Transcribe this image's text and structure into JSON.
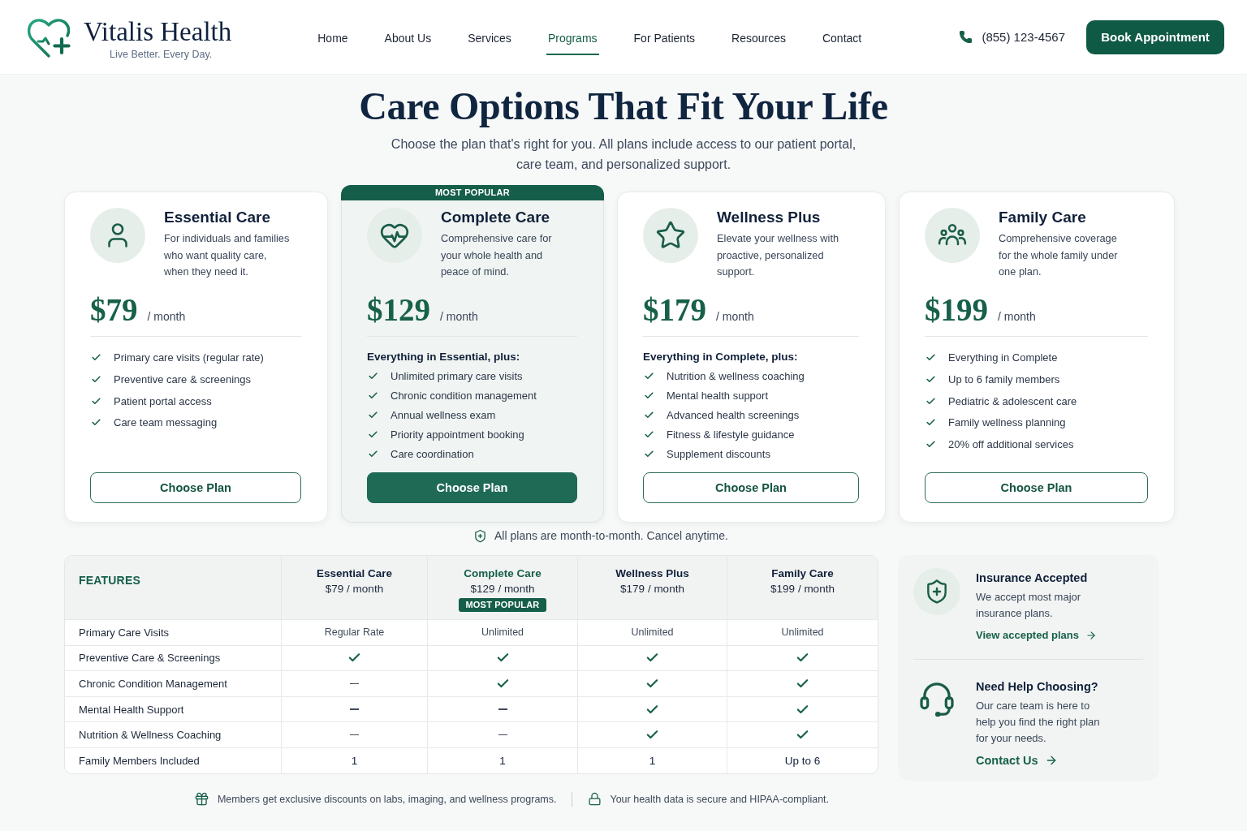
{
  "header": {
    "brand": {
      "name": "Vitalis Health",
      "tagline": "Live Better. Every Day."
    },
    "nav": [
      {
        "label": "Home",
        "selected": false
      },
      {
        "label": "About Us",
        "selected": false
      },
      {
        "label": "Services",
        "selected": false
      },
      {
        "label": "Programs",
        "selected": true
      },
      {
        "label": "For Patients",
        "selected": false
      },
      {
        "label": "Resources",
        "selected": false
      },
      {
        "label": "Contact",
        "selected": false
      }
    ],
    "phone": "(855) 123-4567",
    "cta": "Book Appointment"
  },
  "hero": {
    "title": "Care Options That Fit Your Life",
    "subtitle": "Choose the plan that's right for you. All plans include access to our patient portal, care team, and personalized support."
  },
  "plans": [
    {
      "name": "Essential Care",
      "description": "For individuals and families who want quality care, when they need it.",
      "price": "$79",
      "period": "/ month",
      "highlighted": false,
      "features": [
        "Primary care visits (regular rate)",
        "Preventive care & screenings",
        "Patient portal access",
        "Care team messaging"
      ],
      "button": "Choose Plan"
    },
    {
      "badge": "MOST POPULAR",
      "name": "Complete Care",
      "description": "Comprehensive care for your whole health and peace of mind.",
      "price": "$129",
      "period": "/ month",
      "highlighted": true,
      "features_heading": "Everything in Essential, plus:",
      "features": [
        "Unlimited primary care visits",
        "Chronic condition management",
        "Annual wellness exam",
        "Priority appointment booking",
        "Care coordination"
      ],
      "button": "Choose Plan"
    },
    {
      "name": "Wellness Plus",
      "description": "Elevate your wellness with proactive, personalized support.",
      "price": "$179",
      "period": "/ month",
      "highlighted": false,
      "features_heading": "Everything in Complete, plus:",
      "features": [
        "Nutrition & wellness coaching",
        "Mental health support",
        "Advanced health screenings",
        "Fitness & lifestyle guidance",
        "Supplement discounts"
      ],
      "button": "Choose Plan"
    },
    {
      "name": "Family Care",
      "description": "Comprehensive coverage for the whole family under one plan.",
      "price": "$199",
      "period": "/ month",
      "highlighted": false,
      "features": [
        "Everything in Complete",
        "Up to 6 family members",
        "Pediatric & adolescent care",
        "Family wellness planning",
        "20% off additional services"
      ],
      "button": "Choose Plan"
    }
  ],
  "plans_note": "All plans are month-to-month. Cancel anytime.",
  "comparison": {
    "label": "FEATURES",
    "plans": [
      {
        "name": "Essential Care",
        "price": "$79 / month",
        "highlighted": false
      },
      {
        "name": "Complete Care",
        "price": "$129 / month",
        "badge": "MOST POPULAR",
        "highlighted": true
      },
      {
        "name": "Wellness Plus",
        "price": "$179 / month",
        "highlighted": false
      },
      {
        "name": "Family Care",
        "price": "$199 / month",
        "highlighted": false
      }
    ],
    "rows": [
      {
        "feature": "Primary Care Visits",
        "cells": [
          {
            "kind": "text",
            "text": "Regular Rate"
          },
          {
            "kind": "text",
            "text": "Unlimited"
          },
          {
            "kind": "text",
            "text": "Unlimited"
          },
          {
            "kind": "text",
            "text": "Unlimited"
          }
        ]
      },
      {
        "feature": "Preventive Care & Screenings",
        "cells": [
          {
            "kind": "included",
            "included": true
          },
          {
            "kind": "included",
            "included": true
          },
          {
            "kind": "included",
            "included": true
          },
          {
            "kind": "included",
            "included": true
          }
        ]
      },
      {
        "feature": "Chronic Condition Management",
        "cells": [
          {
            "kind": "included",
            "included": false
          },
          {
            "kind": "included",
            "included": true
          },
          {
            "kind": "included",
            "included": true
          },
          {
            "kind": "included",
            "included": true
          }
        ]
      },
      {
        "feature": "Mental Health Support",
        "cells": [
          {
            "kind": "included",
            "included": false
          },
          {
            "kind": "included",
            "included": false
          },
          {
            "kind": "included",
            "included": true
          },
          {
            "kind": "included",
            "included": true
          }
        ]
      },
      {
        "feature": "Nutrition & Wellness Coaching",
        "cells": [
          {
            "kind": "included",
            "included": false
          },
          {
            "kind": "included",
            "included": false
          },
          {
            "kind": "included",
            "included": true
          },
          {
            "kind": "included",
            "included": true
          }
        ]
      },
      {
        "feature": "Family Members Included",
        "cells": [
          {
            "kind": "count",
            "text": "1"
          },
          {
            "kind": "count",
            "text": "1"
          },
          {
            "kind": "count",
            "text": "1"
          },
          {
            "kind": "count",
            "text": "Up to 6"
          }
        ]
      }
    ]
  },
  "help_panel": {
    "sections": [
      {
        "title": "Insurance Accepted",
        "text": "We accept most major insurance plans.",
        "link": "View accepted plans"
      },
      {
        "title": "Need Help Choosing?",
        "text": "Our care team is here to help you find the right plan for your needs.",
        "link": "Contact Us"
      }
    ]
  },
  "footer_notes": [
    "Members get exclusive discounts on labs, imaging, and wellness programs.",
    "Your health data is secure and HIPAA-compliant."
  ]
}
